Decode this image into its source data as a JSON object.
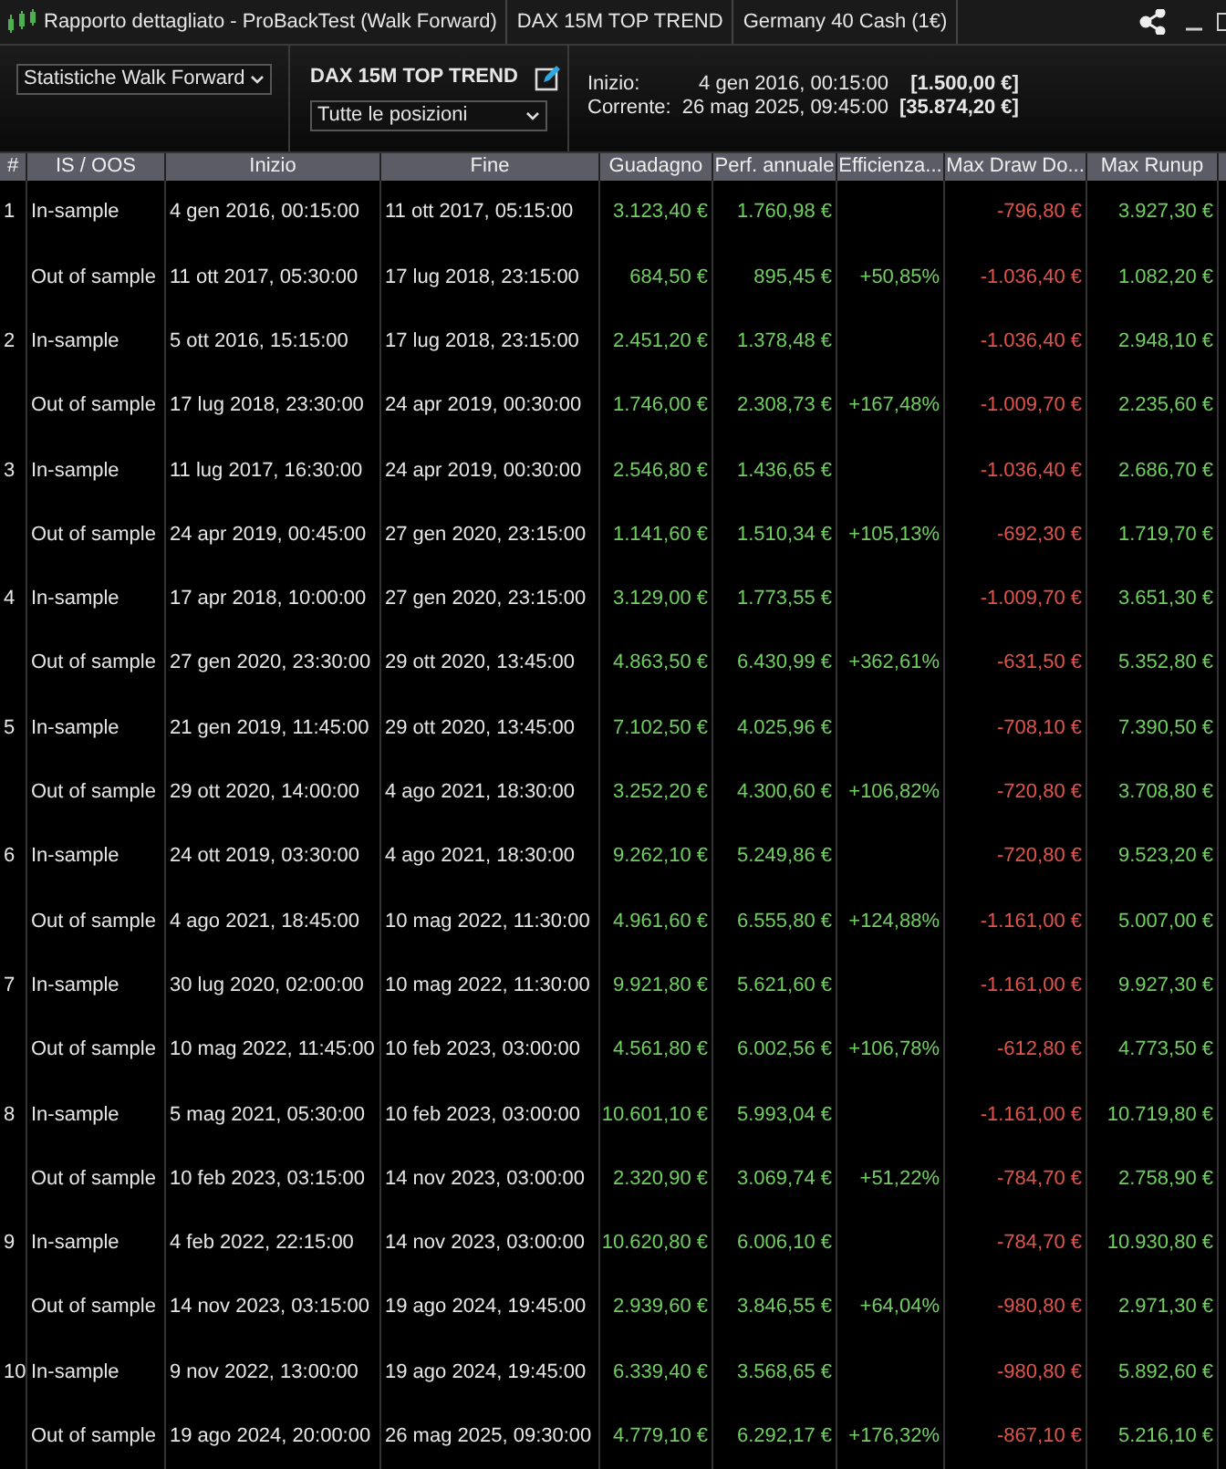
{
  "window": {
    "title": "Rapporto dettagliato - ProBackTest (Walk Forward)",
    "tabs": [
      "DAX 15M TOP TREND",
      "Germany 40 Cash (1€)"
    ]
  },
  "toolbar": {
    "report_select": "Statistiche Walk Forward",
    "strategy_name": "DAX 15M TOP TREND",
    "positions_select": "Tutte le posizioni",
    "start_label": "Inizio:",
    "start_date": "4 gen 2016, 00:15:00",
    "start_value": "[1.500,00 €]",
    "current_label": "Corrente:",
    "current_date": "26 mag 2025, 09:45:00",
    "current_value": "[35.874,20 €]"
  },
  "table": {
    "columns": [
      "#",
      "IS / OOS",
      "Inizio",
      "Fine",
      "Guadagno",
      "Perf. annuale",
      "Efficienza...",
      "Max Draw Do...",
      "Max Runup"
    ],
    "rows": [
      {
        "cells": [
          "1",
          "In-sample",
          "4 gen 2016, 00:15:00",
          "11 ott 2017, 05:15:00",
          "3.123,40 €",
          "1.760,98 €",
          "",
          "-796,80 €",
          "3.927,30 €"
        ]
      },
      {
        "cells": [
          "",
          "Out of sample",
          "11 ott 2017, 05:30:00",
          "17 lug 2018, 23:15:00",
          "684,50 €",
          "895,45 €",
          "+50,85%",
          "-1.036,40 €",
          "1.082,20 €"
        ]
      },
      {
        "cells": [
          "2",
          "In-sample",
          "5 ott 2016, 15:15:00",
          "17 lug 2018, 23:15:00",
          "2.451,20 €",
          "1.378,48 €",
          "",
          "-1.036,40 €",
          "2.948,10 €"
        ]
      },
      {
        "cells": [
          "",
          "Out of sample",
          "17 lug 2018, 23:30:00",
          "24 apr 2019, 00:30:00",
          "1.746,00 €",
          "2.308,73 €",
          "+167,48%",
          "-1.009,70 €",
          "2.235,60 €"
        ]
      },
      {
        "cells": [
          "3",
          "In-sample",
          "11 lug 2017, 16:30:00",
          "24 apr 2019, 00:30:00",
          "2.546,80 €",
          "1.436,65 €",
          "",
          "-1.036,40 €",
          "2.686,70 €"
        ]
      },
      {
        "cells": [
          "",
          "Out of sample",
          "24 apr 2019, 00:45:00",
          "27 gen 2020, 23:15:00",
          "1.141,60 €",
          "1.510,34 €",
          "+105,13%",
          "-692,30 €",
          "1.719,70 €"
        ]
      },
      {
        "cells": [
          "4",
          "In-sample",
          "17 apr 2018, 10:00:00",
          "27 gen 2020, 23:15:00",
          "3.129,00 €",
          "1.773,55 €",
          "",
          "-1.009,70 €",
          "3.651,30 €"
        ]
      },
      {
        "cells": [
          "",
          "Out of sample",
          "27 gen 2020, 23:30:00",
          "29 ott 2020, 13:45:00",
          "4.863,50 €",
          "6.430,99 €",
          "+362,61%",
          "-631,50 €",
          "5.352,80 €"
        ]
      },
      {
        "cells": [
          "5",
          "In-sample",
          "21 gen 2019, 11:45:00",
          "29 ott 2020, 13:45:00",
          "7.102,50 €",
          "4.025,96 €",
          "",
          "-708,10 €",
          "7.390,50 €"
        ]
      },
      {
        "cells": [
          "",
          "Out of sample",
          "29 ott 2020, 14:00:00",
          "4 ago 2021, 18:30:00",
          "3.252,20 €",
          "4.300,60 €",
          "+106,82%",
          "-720,80 €",
          "3.708,80 €"
        ]
      },
      {
        "cells": [
          "6",
          "In-sample",
          "24 ott 2019, 03:30:00",
          "4 ago 2021, 18:30:00",
          "9.262,10 €",
          "5.249,86 €",
          "",
          "-720,80 €",
          "9.523,20 €"
        ]
      },
      {
        "cells": [
          "",
          "Out of sample",
          "4 ago 2021, 18:45:00",
          "10 mag 2022, 11:30:00",
          "4.961,60 €",
          "6.555,80 €",
          "+124,88%",
          "-1.161,00 €",
          "5.007,00 €"
        ]
      },
      {
        "cells": [
          "7",
          "In-sample",
          "30 lug 2020, 02:00:00",
          "10 mag 2022, 11:30:00",
          "9.921,80 €",
          "5.621,60 €",
          "",
          "-1.161,00 €",
          "9.927,30 €"
        ]
      },
      {
        "cells": [
          "",
          "Out of sample",
          "10 mag 2022, 11:45:00",
          "10 feb 2023, 03:00:00",
          "4.561,80 €",
          "6.002,56 €",
          "+106,78%",
          "-612,80 €",
          "4.773,50 €"
        ]
      },
      {
        "cells": [
          "8",
          "In-sample",
          "5 mag 2021, 05:30:00",
          "10 feb 2023, 03:00:00",
          "10.601,10 €",
          "5.993,04 €",
          "",
          "-1.161,00 €",
          "10.719,80 €"
        ]
      },
      {
        "cells": [
          "",
          "Out of sample",
          "10 feb 2023, 03:15:00",
          "14 nov 2023, 03:00:00",
          "2.320,90 €",
          "3.069,74 €",
          "+51,22%",
          "-784,70 €",
          "2.758,90 €"
        ]
      },
      {
        "cells": [
          "9",
          "In-sample",
          "4 feb 2022, 22:15:00",
          "14 nov 2023, 03:00:00",
          "10.620,80 €",
          "6.006,10 €",
          "",
          "-784,70 €",
          "10.930,80 €"
        ]
      },
      {
        "cells": [
          "",
          "Out of sample",
          "14 nov 2023, 03:15:00",
          "19 ago 2024, 19:45:00",
          "2.939,60 €",
          "3.846,55 €",
          "+64,04%",
          "-980,80 €",
          "2.971,30 €"
        ]
      },
      {
        "cells": [
          "10",
          "In-sample",
          "9 nov 2022, 13:00:00",
          "19 ago 2024, 19:45:00",
          "6.339,40 €",
          "3.568,65 €",
          "",
          "-980,80 €",
          "5.892,60 €"
        ]
      },
      {
        "cells": [
          "",
          "Out of sample",
          "19 ago 2024, 20:00:00",
          "26 mag 2025, 09:30:00",
          "4.779,10 €",
          "6.292,17 €",
          "+176,32%",
          "-867,10 €",
          "5.216,10 €"
        ]
      }
    ]
  }
}
